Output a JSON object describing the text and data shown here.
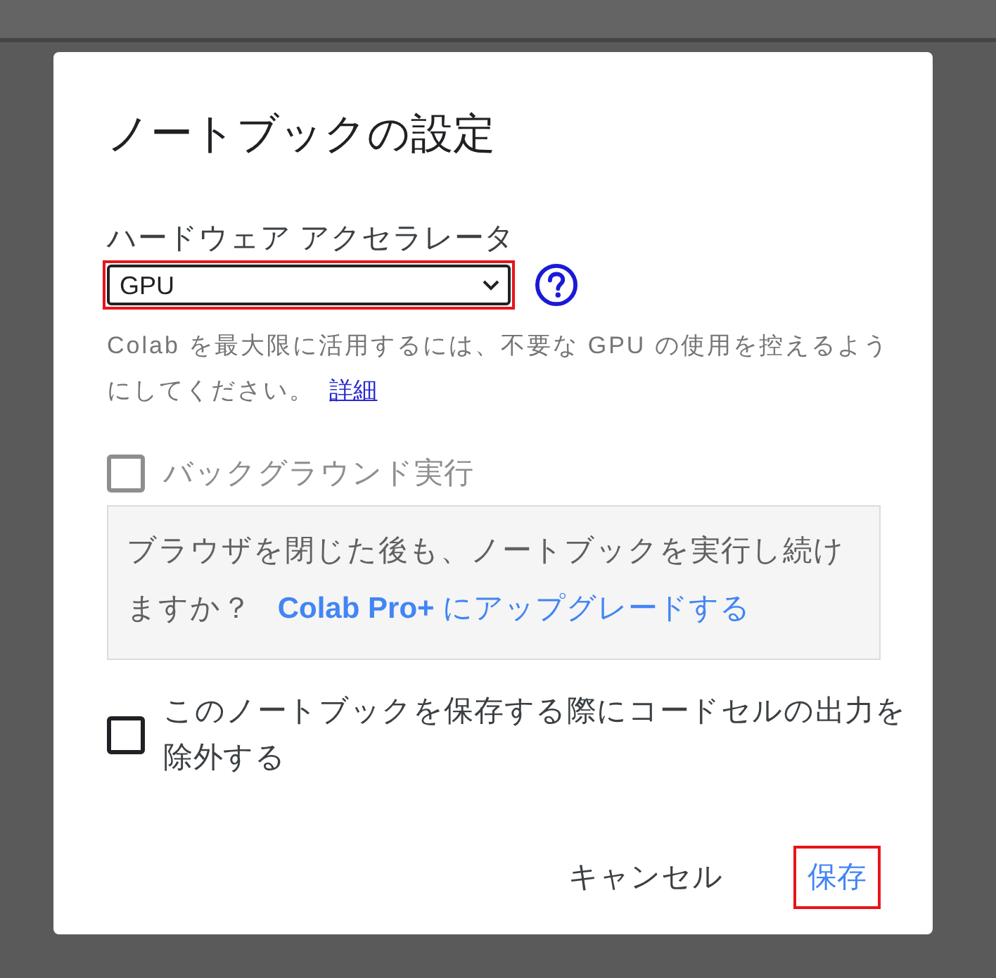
{
  "dialog": {
    "title": "ノートブックの設定",
    "accelerator": {
      "label": "ハードウェア アクセラレータ",
      "value": "GPU",
      "highlighted": true
    },
    "help_text": {
      "text": "Colab を最大限に活用するには、不要な GPU の使用を控えるようにしてください。",
      "link": "詳細"
    },
    "options": [
      {
        "kind": "checkbox",
        "label": "バックグラウンド実行",
        "checked": false,
        "disabled": true,
        "note": {
          "text": "ブラウザを閉じた後も、ノートブックを実行し続けますか？",
          "link": "**Colab Pro+** にアップグレードする"
        }
      },
      {
        "kind": "checkbox",
        "label": "このノートブックを保存する際にコードセルの出力を除外する",
        "checked": false,
        "disabled": false
      }
    ],
    "buttons": [
      {
        "label": "キャンセル",
        "kind": "secondary",
        "highlighted": false
      },
      {
        "label": "保存",
        "kind": "primary",
        "highlighted": true
      }
    ]
  }
}
